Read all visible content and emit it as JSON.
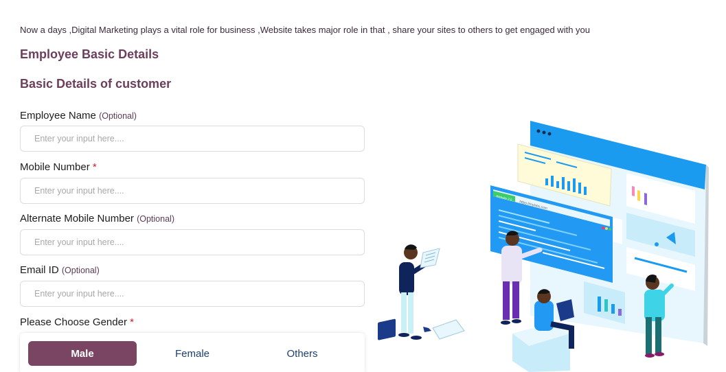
{
  "intro_text": "Now a days ,Digital Marketing plays a vital role for business ,Website takes major role in that , share your sites to others to get engaged with you",
  "section_titles": {
    "employee": "Employee Basic Details",
    "customer": "Basic Details of customer"
  },
  "fields": [
    {
      "label": "Employee Name",
      "optional": "(Optional)",
      "required": "",
      "placeholder": "Enter your input here....",
      "value": ""
    },
    {
      "label": "Mobile Number",
      "optional": "",
      "required": "*",
      "placeholder": "Enter your input here....",
      "value": ""
    },
    {
      "label": "Alternate Mobile Number",
      "optional": "(Optional)",
      "required": "",
      "placeholder": "Enter your input here....",
      "value": ""
    },
    {
      "label": "Email ID",
      "optional": "(Optional)",
      "required": "",
      "placeholder": "Enter your input here....",
      "value": ""
    }
  ],
  "gender": {
    "label": "Please Choose Gender",
    "required": "*",
    "options": [
      "Male",
      "Female",
      "Others"
    ],
    "selected": "Male"
  },
  "illustration": {
    "browser_url": "https://mylobs.com",
    "badge_text": "Website  2.0"
  },
  "colors": {
    "title": "#6b3f5c",
    "accent_button": "#7a4563",
    "option_text": "#1d3f6e",
    "required": "#d11a2a",
    "illustration_blue": "#1a9bf0"
  }
}
